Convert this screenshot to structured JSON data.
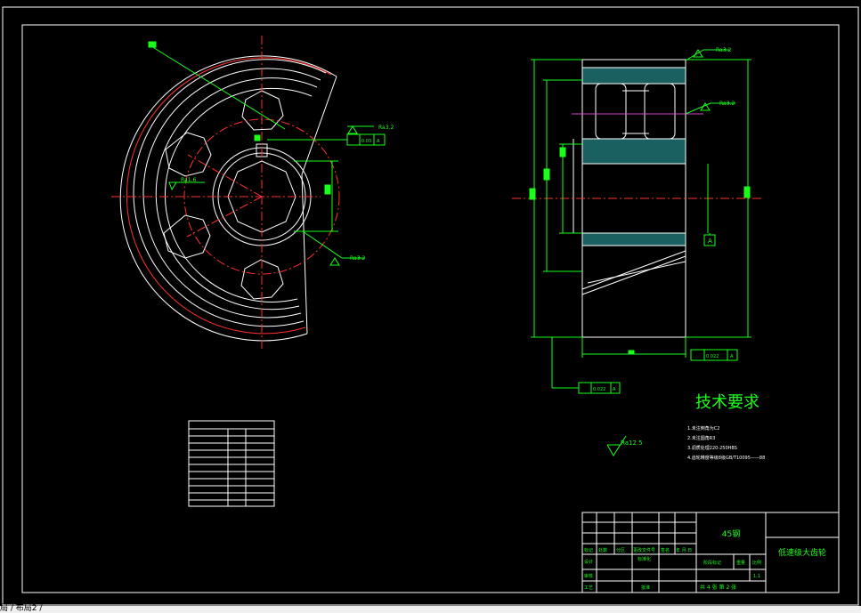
{
  "roughness": {
    "ra32_top": "Ra3.2",
    "ra32_right": "Ra3.2",
    "ra32_keyway": "Ra3.2",
    "ra16": "Ra1.6",
    "ra32_bore": "Ra3.2",
    "ra125": "Ra12.5"
  },
  "tolerances": {
    "keyway_sym": "0.03",
    "runout": "0.022",
    "face_runout": "0.022",
    "datum": "A"
  },
  "tech_requirements": {
    "title": "技术要求",
    "items": [
      "1.未注倒角为C2",
      "2.未注圆角R3",
      "3.调质处理220-250HBS",
      "4.齿轮精度等级8级GB/T10095——88"
    ]
  },
  "title_block": {
    "material": "45钢",
    "part_name": "低速级大齿轮",
    "scale": "1:1",
    "sheet_info": "共 4 张   第 2 张",
    "headers": [
      "标记",
      "处数",
      "分区",
      "更改文件号",
      "签名",
      "年.月.日"
    ],
    "labels": {
      "design": "设计",
      "standardize": "标准化",
      "check": "审核",
      "process": "工艺",
      "approve": "批准",
      "stage_mark": "阶段标记",
      "weight": "重量",
      "ratio": "比例"
    }
  },
  "status_bar": {
    "text": "局 / 布局2 /"
  }
}
